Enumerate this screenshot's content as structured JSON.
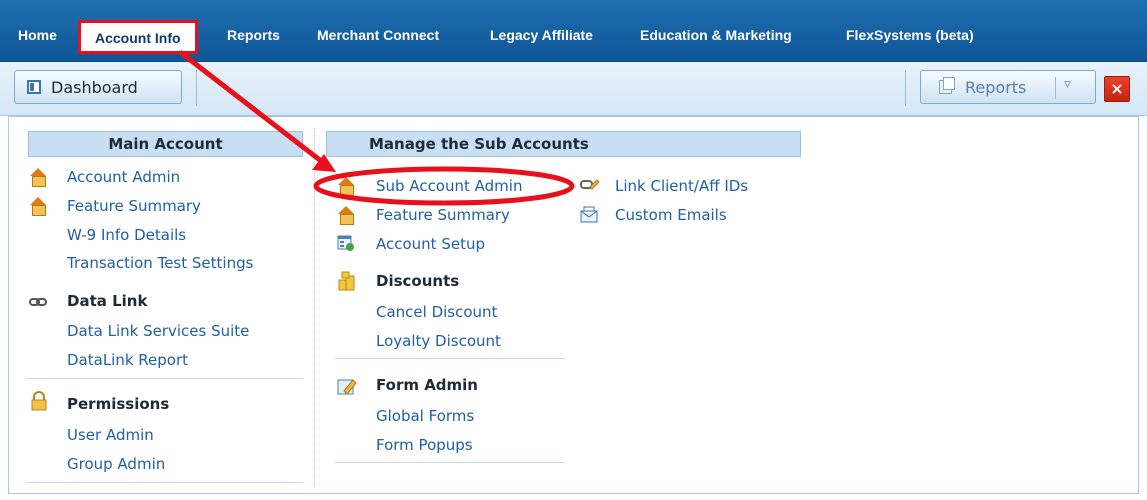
{
  "nav": {
    "items": [
      "Home",
      "Account Info",
      "Reports",
      "Merchant Connect",
      "Legacy Affiliate",
      "Education & Marketing",
      "FlexSystems (beta)"
    ],
    "active": "Account Info"
  },
  "toolbar": {
    "dashboard_label": "Dashboard",
    "reports_label": "Reports",
    "close_symbol": "×"
  },
  "main_account": {
    "header": "Main Account",
    "links": [
      "Account Admin",
      "Feature Summary",
      "W-9 Info Details",
      "Transaction Test Settings"
    ],
    "data_link": {
      "title": "Data Link",
      "links": [
        "Data Link Services Suite",
        "DataLink Report"
      ]
    },
    "permissions": {
      "title": "Permissions",
      "links": [
        "User Admin",
        "Group Admin"
      ]
    }
  },
  "sub_accounts": {
    "header": "Manage the Sub Accounts",
    "links": [
      "Sub Account Admin",
      "Feature Summary",
      "Account Setup"
    ],
    "right_links": [
      "Link Client/Aff IDs",
      "Custom Emails"
    ],
    "discounts": {
      "title": "Discounts",
      "links": [
        "Cancel Discount",
        "Loyalty Discount"
      ]
    },
    "form_admin": {
      "title": "Form Admin",
      "links": [
        "Global Forms",
        "Form Popups"
      ]
    }
  },
  "icons": {
    "house": "house-icon",
    "chain": "chain-link-icon",
    "lock": "padlock-icon",
    "setup": "account-setup-icon",
    "coins": "coins-icon",
    "pencil": "form-edit-icon",
    "tag": "tag-link-icon",
    "envelope": "envelope-icon"
  },
  "colors": {
    "nav_bg": "#0e5597",
    "link": "#1f5fa8",
    "highlight": "#e8101a",
    "header_bg": "#c8def2"
  }
}
